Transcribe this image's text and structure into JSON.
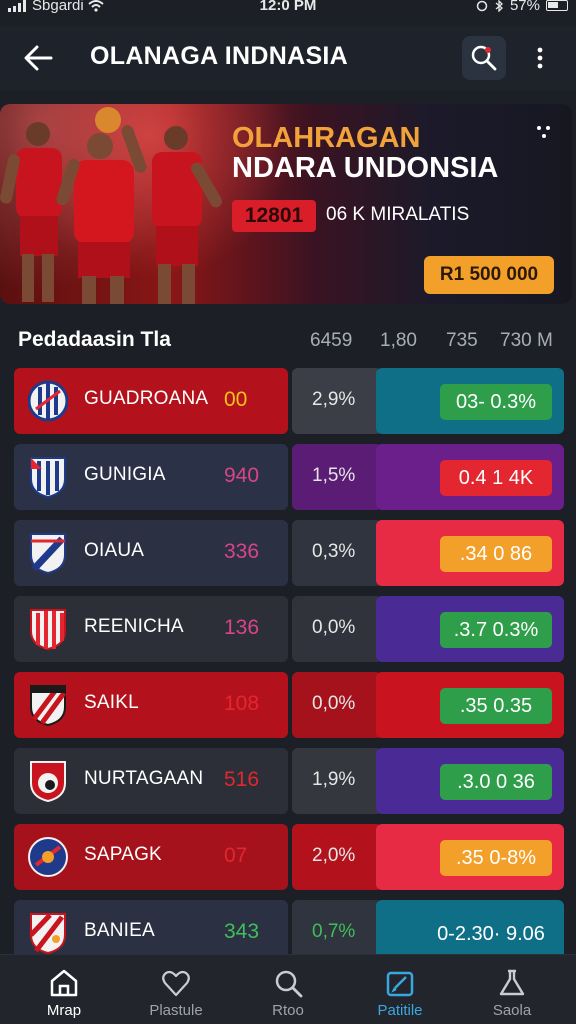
{
  "status": {
    "carrier": "Sbgardi",
    "time": "12:0 PM",
    "battery": "57%"
  },
  "header": {
    "title": "OLANAGA INDNASIA"
  },
  "banner": {
    "title_line1": "OLAHRAGAN",
    "title_line2": "NDARA UNDONSIA",
    "badge": "12801",
    "subtitle": "06 K MIRALATIS",
    "price": "R1 500 000"
  },
  "list": {
    "title": "Pedadaasin Tla",
    "columns": [
      "6459",
      "1,80",
      "735",
      "730 M"
    ],
    "rows": [
      {
        "name": "GUADROANA",
        "score": "00",
        "pct": "2,9%",
        "odds": "03- 0.3%"
      },
      {
        "name": "GUNIGIA",
        "score": "940",
        "pct": "1,5%",
        "odds": "0.4  1 4K"
      },
      {
        "name": "OIAUA",
        "score": "336",
        "pct": "0,3%",
        "odds": ".34  0 86"
      },
      {
        "name": "REENICHA",
        "score": "136",
        "pct": "0,0%",
        "odds": ".3.7  0.3%"
      },
      {
        "name": "SAIKL",
        "score": "108",
        "pct": "0,0%",
        "odds": ".35  0.35"
      },
      {
        "name": "NURTAGAAN",
        "score": "516",
        "pct": "1,9%",
        "odds": ".3.0  0 36"
      },
      {
        "name": "SAPAGK",
        "score": "07",
        "pct": "2,0%",
        "odds": ".35  0-8%"
      },
      {
        "name": "BANIEA",
        "score": "343",
        "pct": "0,7%",
        "odds": "0-2.30· 9.06"
      }
    ]
  },
  "nav": [
    {
      "label": "Mrap",
      "icon": "home-icon"
    },
    {
      "label": "Plastule",
      "icon": "heart-icon"
    },
    {
      "label": "Rtoo",
      "icon": "search-icon"
    },
    {
      "label": "Patitile",
      "icon": "edit-icon"
    },
    {
      "label": "Saola",
      "icon": "flask-icon"
    }
  ],
  "colors": {
    "accent_blue": "#3aa8e0",
    "odds_green": "#2f9e4a",
    "odds_red": "#e3262f",
    "odds_orange": "#f3a02a",
    "banner_orange": "#f2a23a"
  }
}
